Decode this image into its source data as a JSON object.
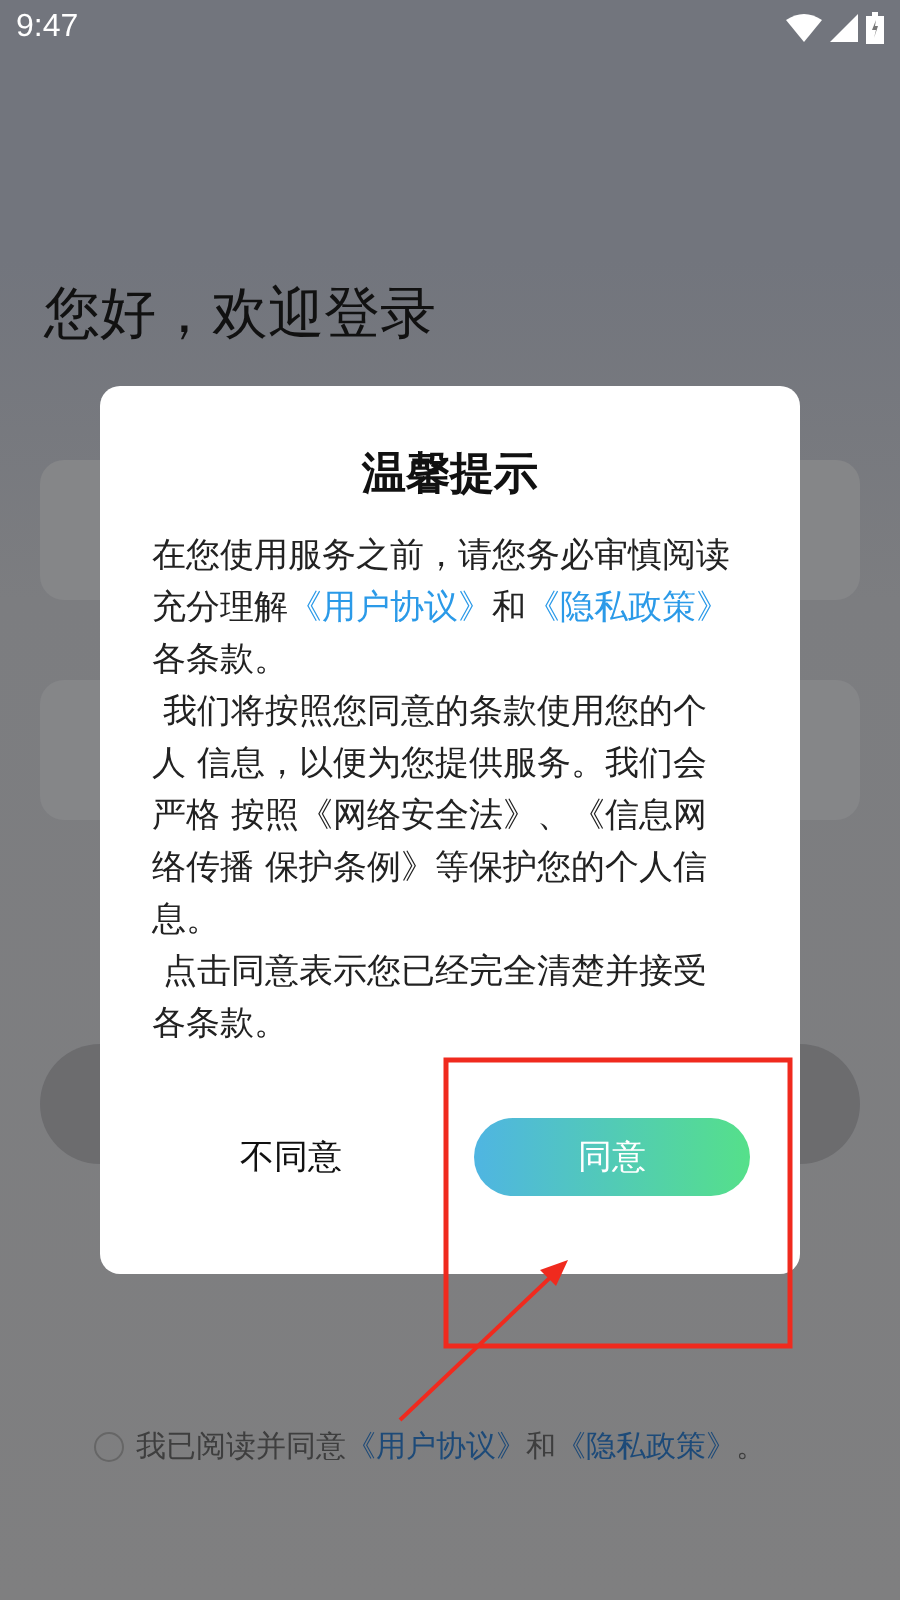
{
  "status_bar": {
    "time": "9:47"
  },
  "login": {
    "heading": "您好，欢迎登录",
    "agreement": {
      "checked": false,
      "segments": [
        {
          "kind": "text",
          "text": "我已阅读并同意"
        },
        {
          "kind": "link",
          "text": "《用户协议》"
        },
        {
          "kind": "text",
          "text": "和"
        },
        {
          "kind": "link",
          "text": "《隐私政策》"
        },
        {
          "kind": "text",
          "text": "。"
        }
      ]
    }
  },
  "dialog": {
    "title": "温馨提示",
    "paragraphs": [
      [
        {
          "kind": "text",
          "text": "在您使用服务之前，请您务必审慎阅读充分理解"
        },
        {
          "kind": "link",
          "text": "《用户协议》"
        },
        {
          "kind": "text",
          "text": "和"
        },
        {
          "kind": "link",
          "text": "《隐私政策》"
        },
        {
          "kind": "text",
          "text": "各条款。"
        }
      ],
      [
        {
          "kind": "text",
          "text": " 我们将按照您同意的条款使用您的个人 信息，以便为您提供服务。我们会严格 按照《网络安全法》、《信息网络传播 保护条例》等保护您的个人信息。"
        }
      ],
      [
        {
          "kind": "text",
          "text": " 点击同意表示您已经完全清楚并接受各条款。"
        }
      ]
    ],
    "buttons": [
      {
        "kind": "plain",
        "label": "不同意"
      },
      {
        "kind": "primary",
        "label": "同意"
      }
    ]
  }
}
